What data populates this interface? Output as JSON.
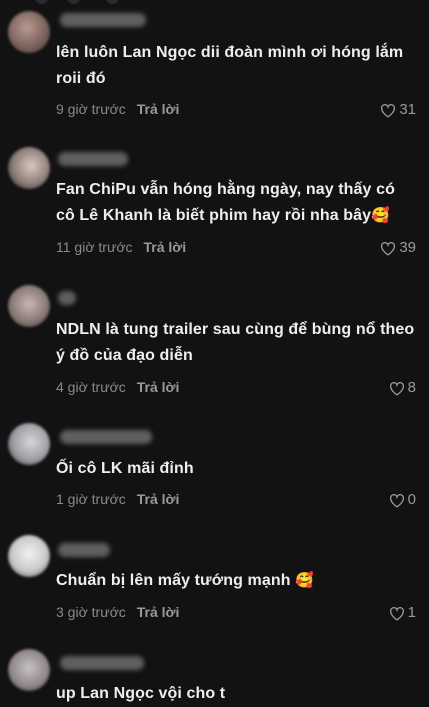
{
  "comments": [
    {
      "text": "lên luôn Lan Ngọc dii đoàn mình ơi hóng lắm roii đó",
      "time": "9 giờ trước",
      "reply": "Trả lời",
      "likes": "31"
    },
    {
      "text": "Fan ChiPu vẫn hóng hằng ngày, nay thấy có cô Lê Khanh là biết phim hay rồi nha bây",
      "emoji": "🥰",
      "time": "11 giờ trước",
      "reply": "Trả lời",
      "likes": "39"
    },
    {
      "text": "NDLN là tung trailer sau cùng để bùng nổ theo ý đồ của đạo diễn",
      "time": "4 giờ trước",
      "reply": "Trả lời",
      "likes": "8"
    },
    {
      "text": "Ối cô LK mãi đỉnh",
      "time": "1 giờ trước",
      "reply": "Trả lời",
      "likes": "0"
    },
    {
      "text": "Chuẩn bị lên mấy tướng mạnh",
      "emoji": "🥰",
      "time": "3 giờ trước",
      "reply": "Trả lời",
      "likes": "1"
    },
    {
      "text": "up Lan Ngọc vội cho t"
    }
  ],
  "colors": {
    "background": "#121212",
    "comment_text": "#eeeeee",
    "meta_text": "#8a8a8b"
  },
  "icons": {
    "like": "heart-outline-icon"
  }
}
